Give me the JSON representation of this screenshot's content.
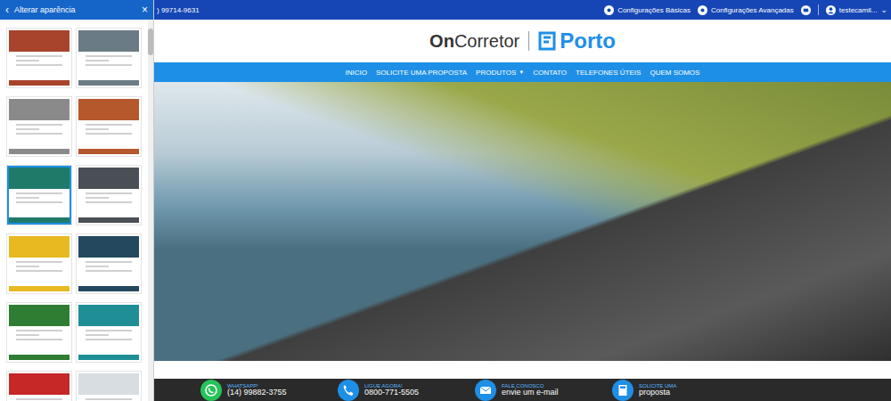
{
  "panel": {
    "title": "Alterar aparência",
    "back": "‹",
    "close": "×",
    "themes": [
      {
        "color": "#a8432c",
        "selected": false
      },
      {
        "color": "#6b7b86",
        "selected": false
      },
      {
        "color": "#8a8a8a",
        "selected": false
      },
      {
        "color": "#b5582c",
        "selected": false
      },
      {
        "color": "#1f7a6a",
        "selected": true
      },
      {
        "color": "#4a4f55",
        "selected": false
      },
      {
        "color": "#e8b920",
        "selected": false
      },
      {
        "color": "#24495e",
        "selected": false
      },
      {
        "color": "#2e7d32",
        "selected": false
      },
      {
        "color": "#1f8f95",
        "selected": false
      },
      {
        "color": "#c62828",
        "selected": false
      },
      {
        "color": "#d8dde2",
        "selected": false
      }
    ]
  },
  "topbar": {
    "phone": ") 99714-9631",
    "links": [
      {
        "label": "Configurações Básicas"
      },
      {
        "label": "Configurações Avançadas"
      }
    ],
    "user": "testecamil...",
    "chevron": "⌄"
  },
  "logo": {
    "brand_bold": "On",
    "brand": "Corretor",
    "partner": "Porto"
  },
  "nav": [
    {
      "label": "INICIO",
      "caret": ""
    },
    {
      "label": "SOLICITE UMA PROPOSTA",
      "caret": ""
    },
    {
      "label": "PRODUTOS",
      "caret": "▼"
    },
    {
      "label": "CONTATO",
      "caret": ""
    },
    {
      "label": "TELEFONES ÚTEIS",
      "caret": ""
    },
    {
      "label": "QUEM SOMOS",
      "caret": ""
    }
  ],
  "footer": [
    {
      "kind": "whatsapp",
      "title": "WHATSAPP!",
      "value": "(14) 99882-3755",
      "color": "#25c45a"
    },
    {
      "kind": "phone",
      "title": "LIGUE AGORA!",
      "value": "0800-771-5505",
      "color": "#1e8fe6"
    },
    {
      "kind": "mail",
      "title": "FALE CONOSCO",
      "value": "envie um e-mail",
      "color": "#1e8fe6"
    },
    {
      "kind": "calc",
      "title": "SOLICITE UMA",
      "value": "proposta",
      "color": "#1e8fe6"
    }
  ]
}
